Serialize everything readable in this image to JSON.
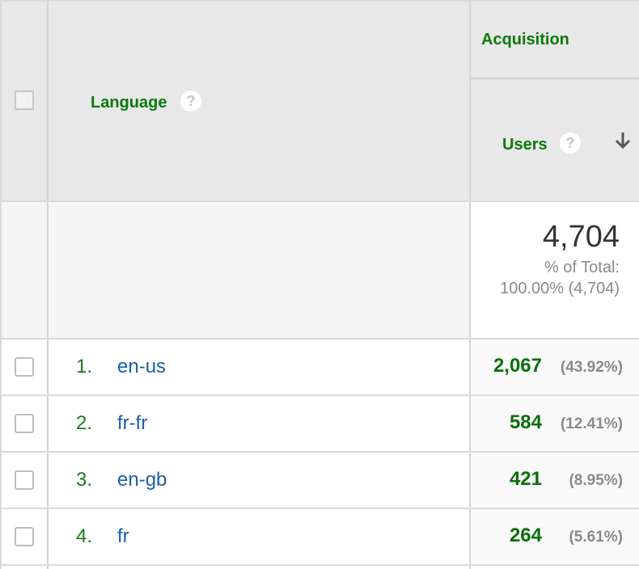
{
  "header": {
    "language_label": "Language",
    "acquisition_label": "Acquisition",
    "users_label": "Users",
    "help_glyph": "?"
  },
  "totals": {
    "users": "4,704",
    "pct_label": "% of Total:",
    "pct_value": "100.00% (4,704)"
  },
  "rows": [
    {
      "index": "1.",
      "language": "en-us",
      "users": "2,067",
      "pct": "(43.92%)"
    },
    {
      "index": "2.",
      "language": "fr-fr",
      "users": "584",
      "pct": "(12.41%)"
    },
    {
      "index": "3.",
      "language": "en-gb",
      "users": "421",
      "pct": "(8.95%)"
    },
    {
      "index": "4.",
      "language": "fr",
      "users": "264",
      "pct": "(5.61%)"
    }
  ],
  "icons": {
    "help": "help-icon",
    "sort": "arrow-down-icon",
    "checkbox": "checkbox-icon"
  },
  "colors": {
    "header_text": "#0a7a0a",
    "link": "#1a5fa8",
    "value": "#0a6e0a",
    "muted": "#8a8a8a",
    "header_bg": "#e8e8e8"
  }
}
